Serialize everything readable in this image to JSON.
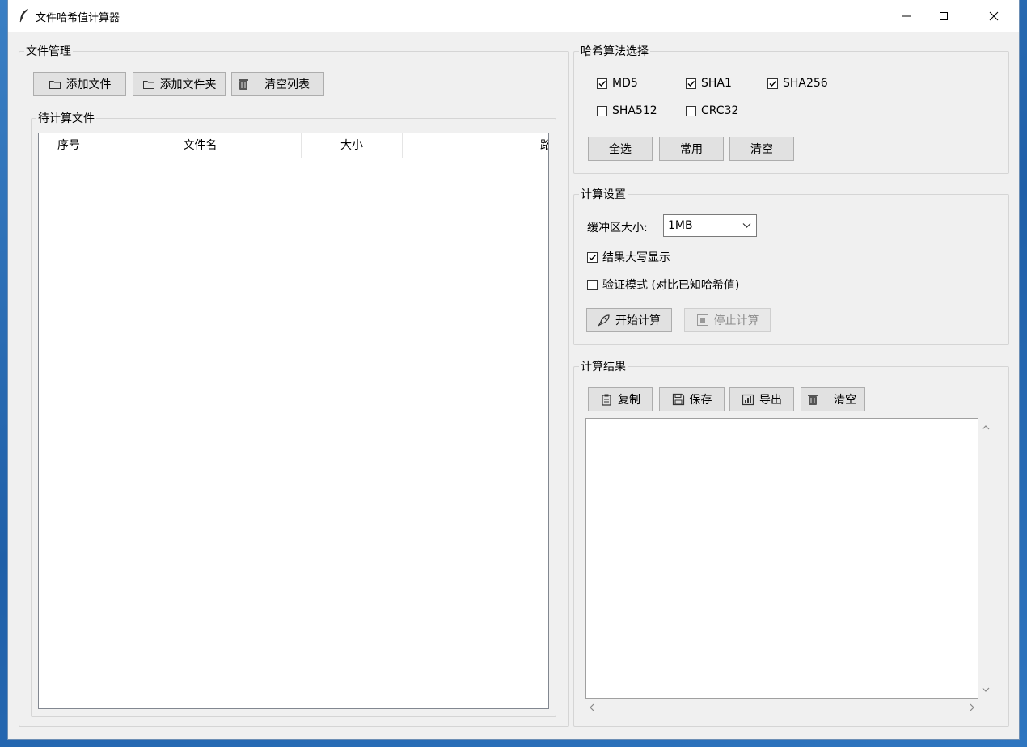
{
  "window": {
    "title": "文件哈希值计算器"
  },
  "file_management": {
    "legend": "文件管理",
    "add_file": "添加文件",
    "add_folder": "添加文件夹",
    "clear_list": "清空列表",
    "pending_legend": "待计算文件",
    "columns": [
      "序号",
      "文件名",
      "大小",
      "路"
    ]
  },
  "algorithms": {
    "legend": "哈希算法选择",
    "items": [
      {
        "label": "MD5",
        "checked": true
      },
      {
        "label": "SHA1",
        "checked": true
      },
      {
        "label": "SHA256",
        "checked": true
      },
      {
        "label": "SHA512",
        "checked": false
      },
      {
        "label": "CRC32",
        "checked": false
      }
    ],
    "select_all": "全选",
    "common": "常用",
    "clear": "清空"
  },
  "settings": {
    "legend": "计算设置",
    "buffer_label": "缓冲区大小:",
    "buffer_value": "1MB",
    "uppercase_label": "结果大写显示",
    "uppercase_checked": true,
    "verify_label": "验证模式 (对比已知哈希值)",
    "verify_checked": false,
    "start_label": "开始计算",
    "stop_label": "停止计算"
  },
  "results": {
    "legend": "计算结果",
    "copy": "复制",
    "save": "保存",
    "export": "导出",
    "clear": "清空"
  }
}
